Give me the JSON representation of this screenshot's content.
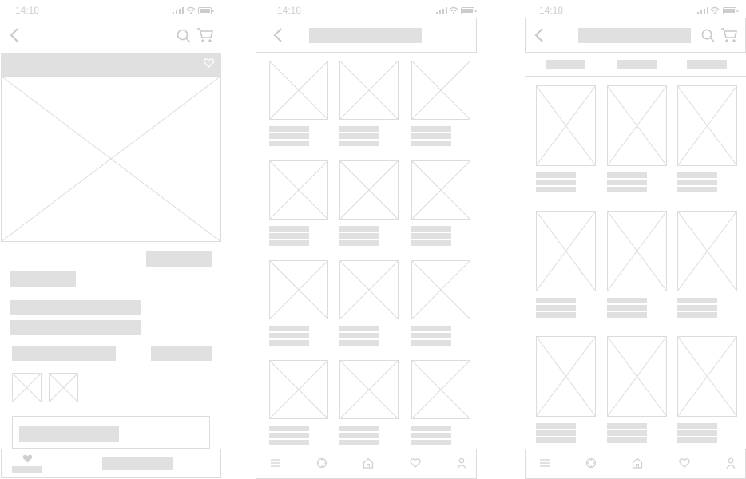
{
  "status_bar": {
    "time": "14:18"
  },
  "colors": {
    "placeholder": "#e0e0e0",
    "outline": "#dcdcdc",
    "icon": "#cccccc"
  },
  "screens": [
    {
      "name": "product-detail"
    },
    {
      "name": "product-grid"
    },
    {
      "name": "product-grid-with-filters"
    }
  ]
}
